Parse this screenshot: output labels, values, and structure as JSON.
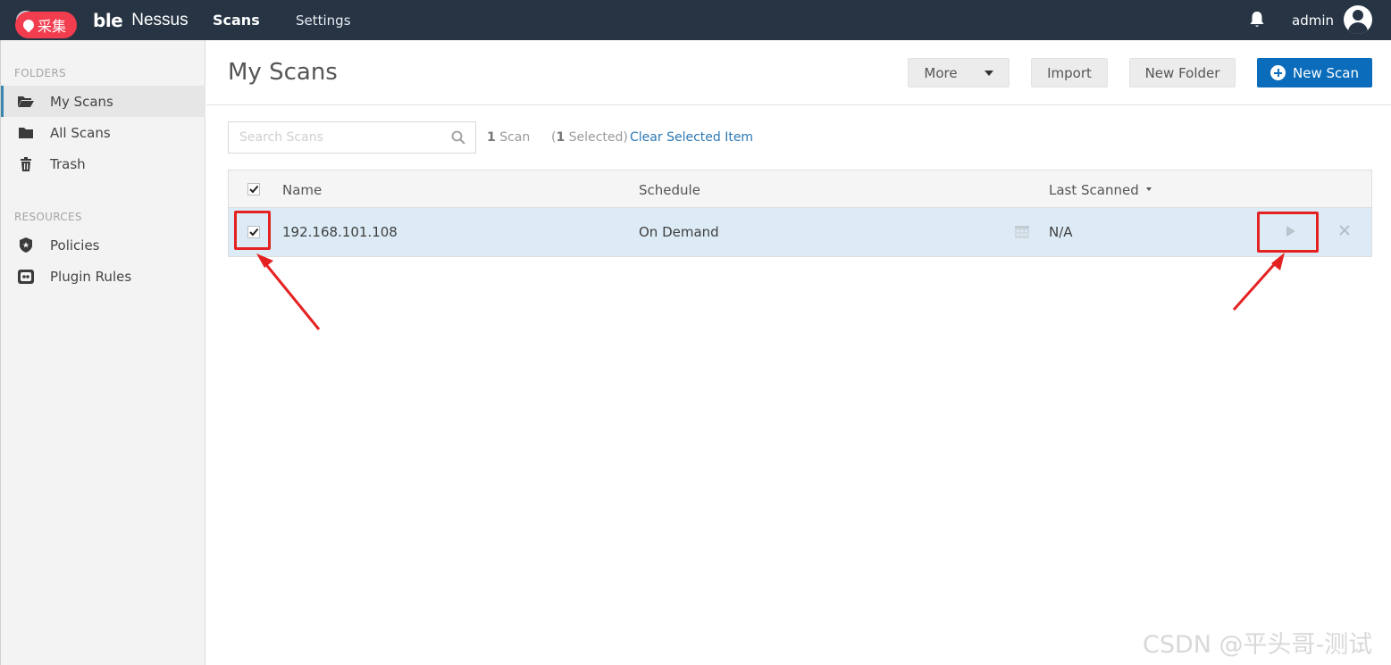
{
  "header": {
    "brand_strong": "ble",
    "brand_product": "Nessus",
    "badge": "采集",
    "nav": {
      "scans": "Scans",
      "settings": "Settings"
    },
    "user": "admin"
  },
  "sidebar": {
    "folders_heading": "FOLDERS",
    "folders": [
      {
        "label": "My Scans",
        "icon": "folder-open-icon",
        "active": true
      },
      {
        "label": "All Scans",
        "icon": "folder-icon"
      },
      {
        "label": "Trash",
        "icon": "trash-icon"
      }
    ],
    "resources_heading": "RESOURCES",
    "resources": [
      {
        "label": "Policies",
        "icon": "shield-icon"
      },
      {
        "label": "Plugin Rules",
        "icon": "plugin-rules-icon"
      }
    ]
  },
  "main": {
    "title": "My Scans",
    "buttons": {
      "more": "More",
      "import": "Import",
      "new_folder": "New Folder",
      "new_scan": "New Scan"
    },
    "search": {
      "placeholder": "Search Scans",
      "value": ""
    },
    "scan_count_num": "1",
    "scan_count_label": " Scan",
    "selected_open": "(",
    "selected_num": "1",
    "selected_rest": " Selected)",
    "clear_link": "Clear Selected Item",
    "table": {
      "columns": {
        "name": "Name",
        "schedule": "Schedule",
        "last_scanned": "Last Scanned"
      },
      "rows": [
        {
          "name": "192.168.101.108",
          "schedule": "On Demand",
          "last_scanned": "N/A",
          "selected": true
        }
      ]
    }
  },
  "colors": {
    "topbar": "#263444",
    "primary": "#0a6cba",
    "annotation": "#e52222",
    "row_selected": "#dcebf5"
  },
  "watermark": "CSDN @平头哥-测试"
}
